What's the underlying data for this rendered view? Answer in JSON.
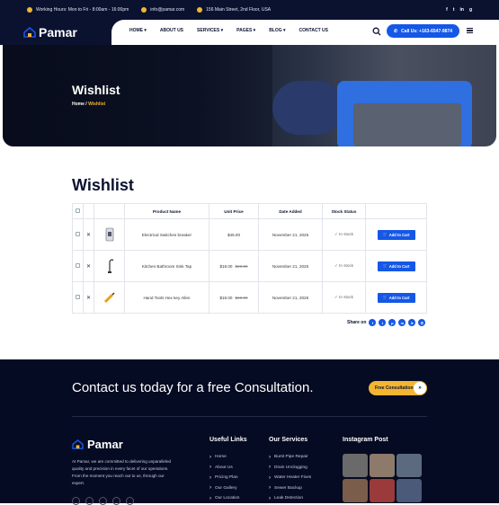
{
  "topbar": {
    "hours": "Working Hours: Mon to Fri - 8:00am - 16:00pm",
    "email": "info@pamar.com",
    "address": "156 Main Street, 2nd Floor, USA",
    "social": [
      "f",
      "t",
      "in",
      "g"
    ]
  },
  "header": {
    "logo": "Pamar",
    "menu": [
      "HOME",
      "ABOUT US",
      "SERVICES",
      "PAGES",
      "BLOG",
      "CONTACT US"
    ],
    "call_label": "Call Us: +163-6547-9874"
  },
  "hero": {
    "title": "Wishlist",
    "crumb_home": "Home",
    "crumb_sep": "/",
    "crumb_current": "Wishlist"
  },
  "wishlist": {
    "heading": "Wishlist",
    "columns": [
      "Product Name",
      "Unit Price",
      "Date Added",
      "Stock Status"
    ],
    "rows": [
      {
        "name": "Electrical Switches breaker",
        "price": "$45.00",
        "old_price": "",
        "date": "November 21, 2025",
        "stock": "In stock",
        "action": "Add to Cart"
      },
      {
        "name": "Kitchen Bathroom Sink Tap",
        "price": "$18.00",
        "old_price": "$20.00",
        "date": "November 21, 2025",
        "stock": "In stock",
        "action": "Add to Cart"
      },
      {
        "name": "Hand Tools Hex key Allen",
        "price": "$18.00",
        "old_price": "$20.00",
        "date": "November 21, 2025",
        "stock": "In stock",
        "action": "Add to Cart"
      }
    ],
    "share_label": "Share on",
    "share_icons": [
      "facebook-icon",
      "twitter-icon",
      "pinterest-icon",
      "linkedin-icon",
      "telegram-icon",
      "whatsapp-icon"
    ]
  },
  "footer": {
    "cta_text": "Contact us today for a free Consultation.",
    "cta_button": "Free Consultation",
    "cta_arrow": "»",
    "logo": "Pamar",
    "description": "At Pamar, we are committed to delivering unparalleled quality and precision in every facet of our operations. From the moment you reach out to us, through our expert.",
    "useful_links_title": "Useful Links",
    "useful_links": [
      "Home",
      "About Us",
      "Pricing Plan",
      "Our Gallery",
      "Our Location"
    ],
    "services_title": "Our Services",
    "services": [
      "Burst Pipe Repair",
      "Drain Unclogging",
      "Water Heater Fixes",
      "Sewer Backup",
      "Leak Detection"
    ],
    "instagram_title": "Instagram Post"
  },
  "colors": {
    "navy": "#0b1230",
    "accent_blue": "#1557e6",
    "accent_yellow": "#f2b632"
  }
}
